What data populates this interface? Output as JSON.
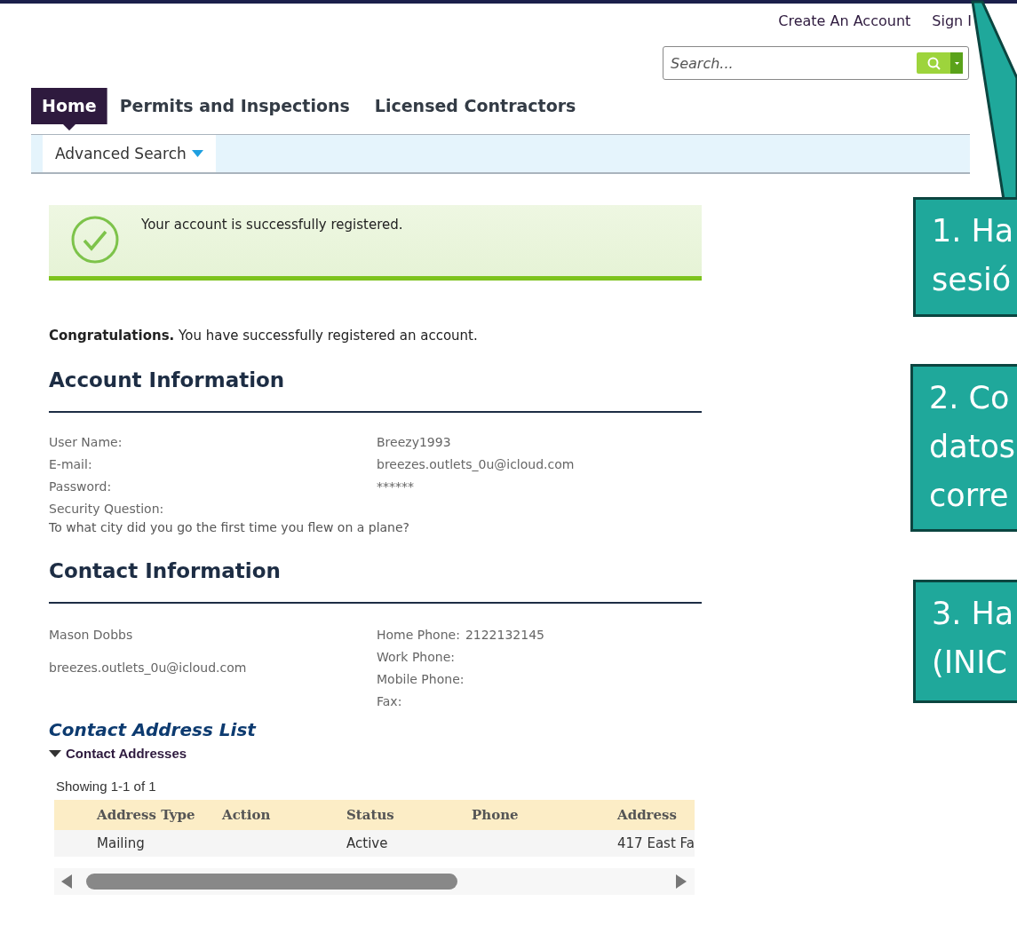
{
  "top_links": [
    {
      "label": "Create An Account"
    },
    {
      "label": "Sign I"
    }
  ],
  "search": {
    "placeholder": "Search..."
  },
  "tabs": [
    {
      "label": "Home",
      "selected": true
    },
    {
      "label": "Permits and Inspections",
      "selected": false
    },
    {
      "label": "Licensed Contractors",
      "selected": false
    }
  ],
  "subnav": {
    "label": "Advanced Search"
  },
  "banner": {
    "message": "Your account is successfully registered."
  },
  "intro": "**Congratulations.** You have successfully registered an account.",
  "account_information": {
    "title": "Account Information",
    "fields": [
      {
        "label": "User Name:",
        "value": "Breezy1993"
      },
      {
        "label": "E-mail:",
        "value": "breezes.outlets_0u@icloud.com"
      },
      {
        "label": "Password:",
        "value": "******"
      }
    ],
    "security_question": {
      "label": "Security Question:",
      "text": "To what city did you go the first time you flew on a plane?"
    }
  },
  "contact_information": {
    "title": "Contact Information",
    "name": "Mason Dobbs",
    "email": "breezes.outlets_0u@icloud.com",
    "phones": [
      {
        "label": "Home Phone:",
        "value": "2122132145"
      },
      {
        "label": "Work Phone:"
      },
      {
        "label": "Mobile Phone:"
      },
      {
        "label": "Fax:"
      }
    ]
  },
  "address_list": {
    "title": "Contact Address List",
    "section": {
      "label": "Contact Addresses",
      "expanded": true
    },
    "summary": "Showing 1-1 of 1",
    "columns": [
      {
        "label": "Address Type"
      },
      {
        "label": "Action"
      },
      {
        "label": "Status"
      },
      {
        "label": "Phone"
      },
      {
        "label": "Address"
      }
    ],
    "rows": [
      {
        "cells": [
          "Mailing",
          null,
          "Active",
          null,
          "417 East Fa"
        ]
      }
    ]
  },
  "callouts": [
    {
      "lines": [
        "1. Ha",
        "sesió"
      ]
    },
    {
      "lines": [
        "2. Co",
        "datos",
        "corre"
      ]
    },
    {
      "lines": [
        "3. Ha",
        "(INIC"
      ]
    }
  ]
}
